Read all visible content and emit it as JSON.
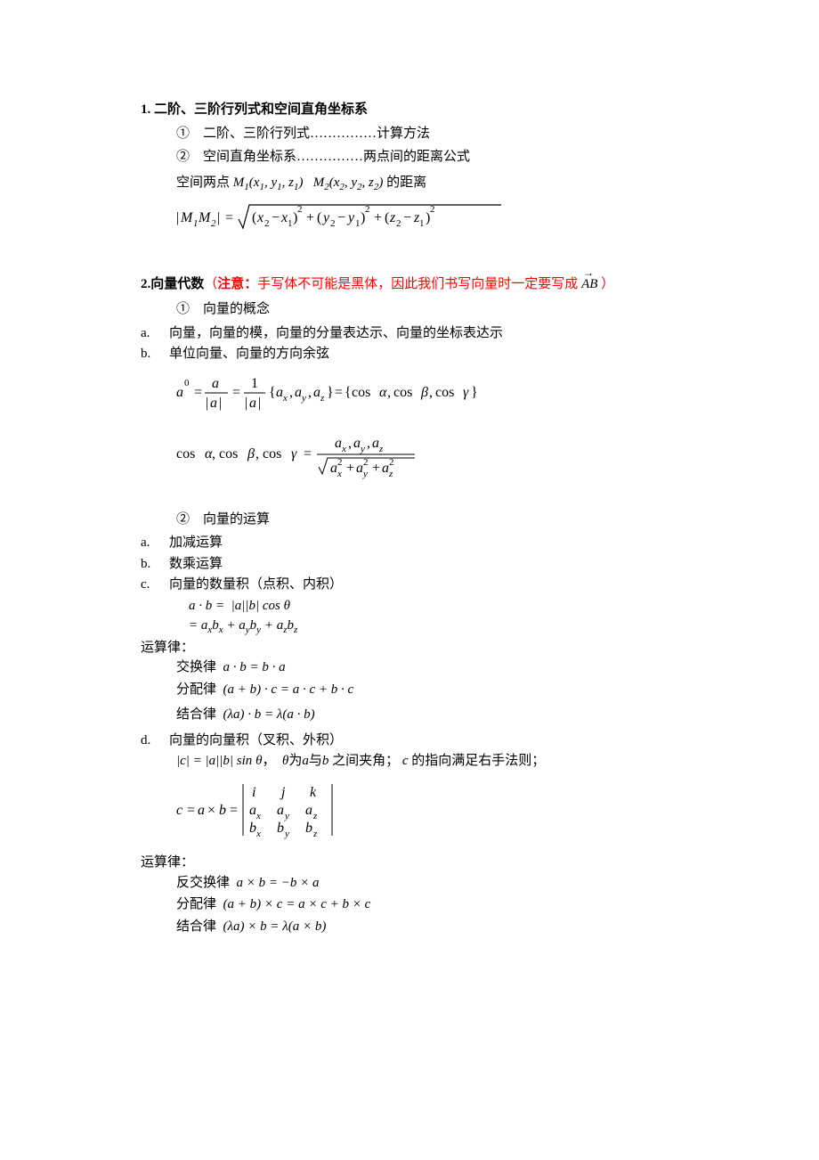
{
  "s1": {
    "title": "1. 二阶、三阶行列式和空间直角坐标系",
    "i1": "①　二阶、三阶行列式……………计算方法",
    "i2": "②　空间直角坐标系……………两点间的距离公式",
    "pts_a": "空间两点",
    "pts_m1": "M₁(x₁, y₁, z₁)",
    "pts_m2": "M₂(x₂, y₂, z₂)",
    "pts_b": "的距离"
  },
  "s2": {
    "title": "2.向量代数",
    "paren_l": "（",
    "note_label": "注意：",
    "note_body": "手写体不可能是黑体，因此我们书写向量时一定要写成",
    "vec": "AB",
    "paren_r": "）",
    "i1": "①　向量的概念",
    "a": "向量，向量的模，向量的分量表达示、向量的坐标表达示",
    "b": "单位向量、向量的方向余弦",
    "i2": "②　向量的运算",
    "op_a": "加减运算",
    "op_b": "数乘运算",
    "op_c": "向量的数量积（点积、内积）",
    "law_head": "运算律：",
    "law_comm": "交换律",
    "law_dist": "分配律",
    "law_assoc": "结合律",
    "op_d": "向量的向量积（叉积、外积）",
    "cross_mid1": "，",
    "cross_mid2": "之间夹角；",
    "cross_tail": "的指向满足右手法则；",
    "law_head2": "运算律：",
    "law_anti": "反交换律",
    "law_dist2": "分配律",
    "law_assoc2": "结合律",
    "dot_eq1": "a · b =  |a||b| cos θ",
    "dot_eq2": "= aₓbₓ + aᵧbᵧ + a_z b_z",
    "dot_comm": "a · b = b · a",
    "dot_dist": "(a + b) · c = a · c + b · c",
    "dot_assoc": "(λa) · b = λ(a · b)",
    "cross_mag": "|c| = |a||b| sin θ",
    "cross_angle": "θ为a与b",
    "cross_dir": "c",
    "cross_anti": "a × b = −b × a",
    "cross_dist": "(a + b) × c = a × c + b × c",
    "cross_assoc": "(λa) × b = λ(a × b)"
  }
}
